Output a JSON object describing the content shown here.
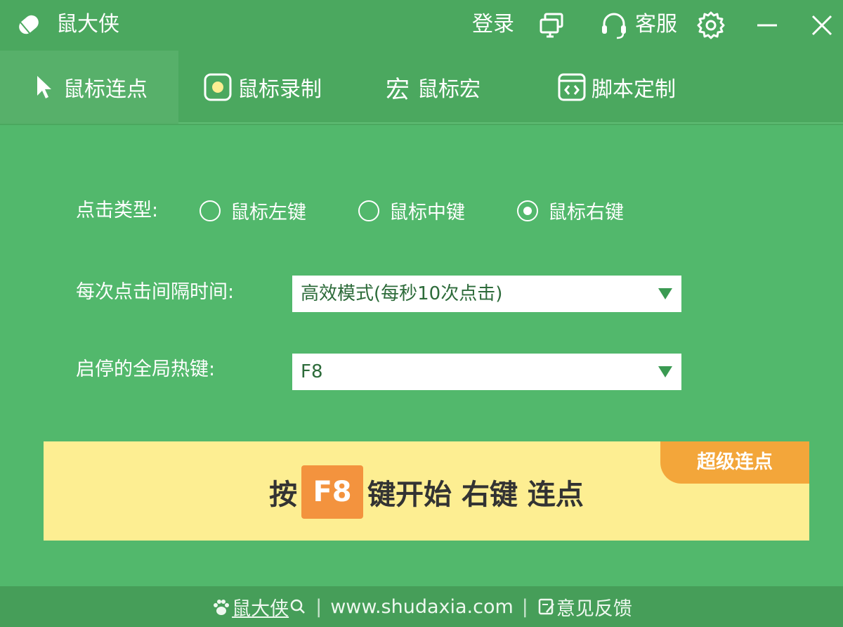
{
  "titlebar": {
    "title": "鼠大侠",
    "login": "登录",
    "service": "客服"
  },
  "tabs": [
    {
      "label": "鼠标连点",
      "icon": "cursor-icon",
      "active": true
    },
    {
      "label": "鼠标录制",
      "icon": "record-icon",
      "active": false
    },
    {
      "label": "鼠标宏",
      "icon": "macro-icon",
      "icon_text": "宏",
      "active": false
    },
    {
      "label": "脚本定制",
      "icon": "script-icon",
      "active": false
    }
  ],
  "form": {
    "click_type_label": "点击类型:",
    "click_types": [
      {
        "label": "鼠标左键",
        "selected": false
      },
      {
        "label": "鼠标中键",
        "selected": false
      },
      {
        "label": "鼠标右键",
        "selected": true
      }
    ],
    "interval_label": "每次点击间隔时间:",
    "interval_value": "高效模式(每秒10次点击)",
    "hotkey_label": "启停的全局热键:",
    "hotkey_value": "F8"
  },
  "banner": {
    "badge": "超级连点",
    "prefix": "按",
    "key": "F8",
    "suffix": "键开始 右键 连点"
  },
  "footer": {
    "brand": "鼠大侠",
    "website": "www.shudaxia.com",
    "feedback": "意见反馈",
    "separator": "|"
  },
  "colors": {
    "titlebar": "#4ba85f",
    "main": "#52b86c",
    "banner": "#fdee92",
    "badge": "#f3a63a",
    "key": "#f3933e",
    "footer": "#469e59"
  }
}
